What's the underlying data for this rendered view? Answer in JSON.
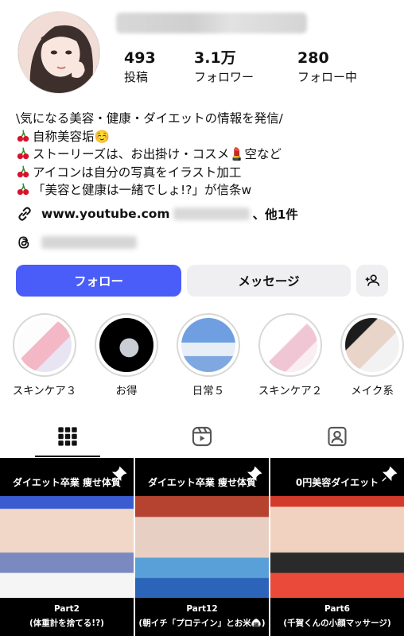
{
  "profile": {
    "stats": [
      {
        "number": "493",
        "label": "投稿"
      },
      {
        "number": "3.1万",
        "label": "フォロワー"
      },
      {
        "number": "280",
        "label": "フォロー中"
      }
    ],
    "bio_lines": [
      "\\気になる美容・健康・ダイエットの情報を発信/",
      "自称美容垢☺️",
      "ストーリーズは、お出掛け・コスメ💄空など",
      "アイコンは自分の写真をイラスト加工",
      "「美容と健康は一緒でしょ!?」が信条w"
    ],
    "link_prefix": "www.youtube.com",
    "link_suffix": "、他1件"
  },
  "actions": {
    "follow_label": "フォロー",
    "message_label": "メッセージ"
  },
  "highlights": [
    {
      "label": "スキンケア３"
    },
    {
      "label": "お得"
    },
    {
      "label": "日常５"
    },
    {
      "label": "スキンケア２"
    },
    {
      "label": "メイク系"
    }
  ],
  "posts": [
    {
      "title": "ダイエット卒業 痩せ体質",
      "caption_1": "Part2",
      "caption_2": "(体重計を捨てる!?)"
    },
    {
      "title": "ダイエット卒業 痩せ体質",
      "caption_1": "Part12",
      "caption_2": "(朝イチ「プロテイン」とお米🍙)"
    },
    {
      "title": "0円美容ダイエット",
      "caption_1": "Part6",
      "caption_2": "(千賀くんの小顔マッサージ)"
    }
  ],
  "colors": {
    "follow_button": "#4a5df9",
    "secondary_button": "#efeff1"
  }
}
